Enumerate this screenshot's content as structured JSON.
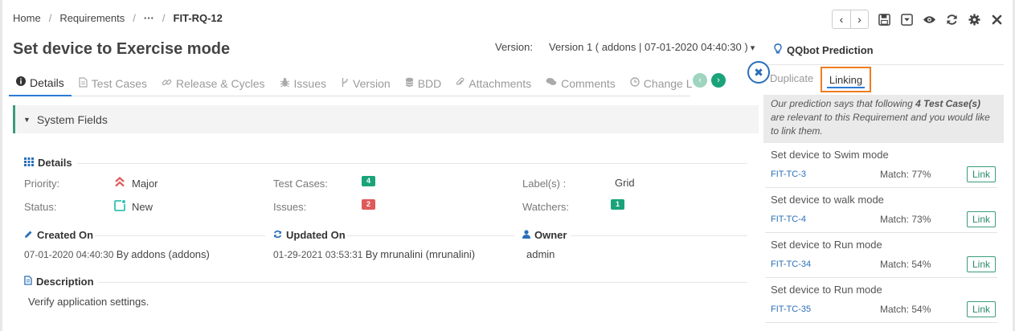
{
  "breadcrumb": {
    "home": "Home",
    "requirements": "Requirements",
    "ellipsis": "···",
    "current": "FIT-RQ-12"
  },
  "page": {
    "title": "Set device to Exercise mode"
  },
  "version": {
    "label": "Version:",
    "value": "Version 1 ( addons | 07-01-2020 04:40:30 )"
  },
  "tabs": [
    {
      "label": "Details",
      "icon": "info-icon"
    },
    {
      "label": "Test Cases",
      "icon": "document-icon"
    },
    {
      "label": "Release & Cycles",
      "icon": "link-icon"
    },
    {
      "label": "Issues",
      "icon": "bug-icon"
    },
    {
      "label": "Version",
      "icon": "branch-icon"
    },
    {
      "label": "BDD",
      "icon": "database-icon"
    },
    {
      "label": "Attachments",
      "icon": "paperclip-icon"
    },
    {
      "label": "Comments",
      "icon": "comments-icon"
    },
    {
      "label": "Change L",
      "icon": "clock-icon"
    }
  ],
  "system_fields": {
    "header": "System Fields"
  },
  "details": {
    "title": "Details",
    "priority_label": "Priority:",
    "priority_value": "Major",
    "status_label": "Status:",
    "status_value": "New",
    "test_cases_label": "Test Cases:",
    "test_cases_count": "4",
    "issues_label": "Issues:",
    "issues_count": "2",
    "labels_label": "Label(s) :",
    "labels_value": "Grid",
    "watchers_label": "Watchers:",
    "watchers_count": "1"
  },
  "created": {
    "title": "Created On",
    "date": "07-01-2020 04:40:30",
    "by": "By",
    "user": "addons (addons)"
  },
  "updated": {
    "title": "Updated On",
    "date": "01-29-2021 03:53:31",
    "by": "By",
    "user": "mrunalini (mrunalini)"
  },
  "owner": {
    "title": "Owner",
    "value": "admin"
  },
  "description": {
    "title": "Description",
    "text": "Verify application settings."
  },
  "prediction": {
    "title": "QQbot Prediction",
    "tab_duplicate": "Duplicate",
    "tab_linking": "Linking",
    "msg_pre": "Our prediction says that following ",
    "msg_bold": "4 Test Case(s)",
    "msg_post": " are relevant to this Requirement and you would like to link them.",
    "link_label": "Link",
    "items": [
      {
        "title": "Set device to Swim mode",
        "id": "FIT-TC-3",
        "match": "Match: 77%"
      },
      {
        "title": "Set device to walk mode",
        "id": "FIT-TC-4",
        "match": "Match: 73%"
      },
      {
        "title": "Set device to Run mode",
        "id": "FIT-TC-34",
        "match": "Match: 54%"
      },
      {
        "title": "Set device to Run mode",
        "id": "FIT-TC-35",
        "match": "Match: 54%"
      }
    ]
  },
  "colors": {
    "accent": "#2a7bd4",
    "green": "#1aa37a",
    "red": "#e05a5a",
    "orange": "#ee7d1e",
    "teal": "#33c2b3"
  }
}
